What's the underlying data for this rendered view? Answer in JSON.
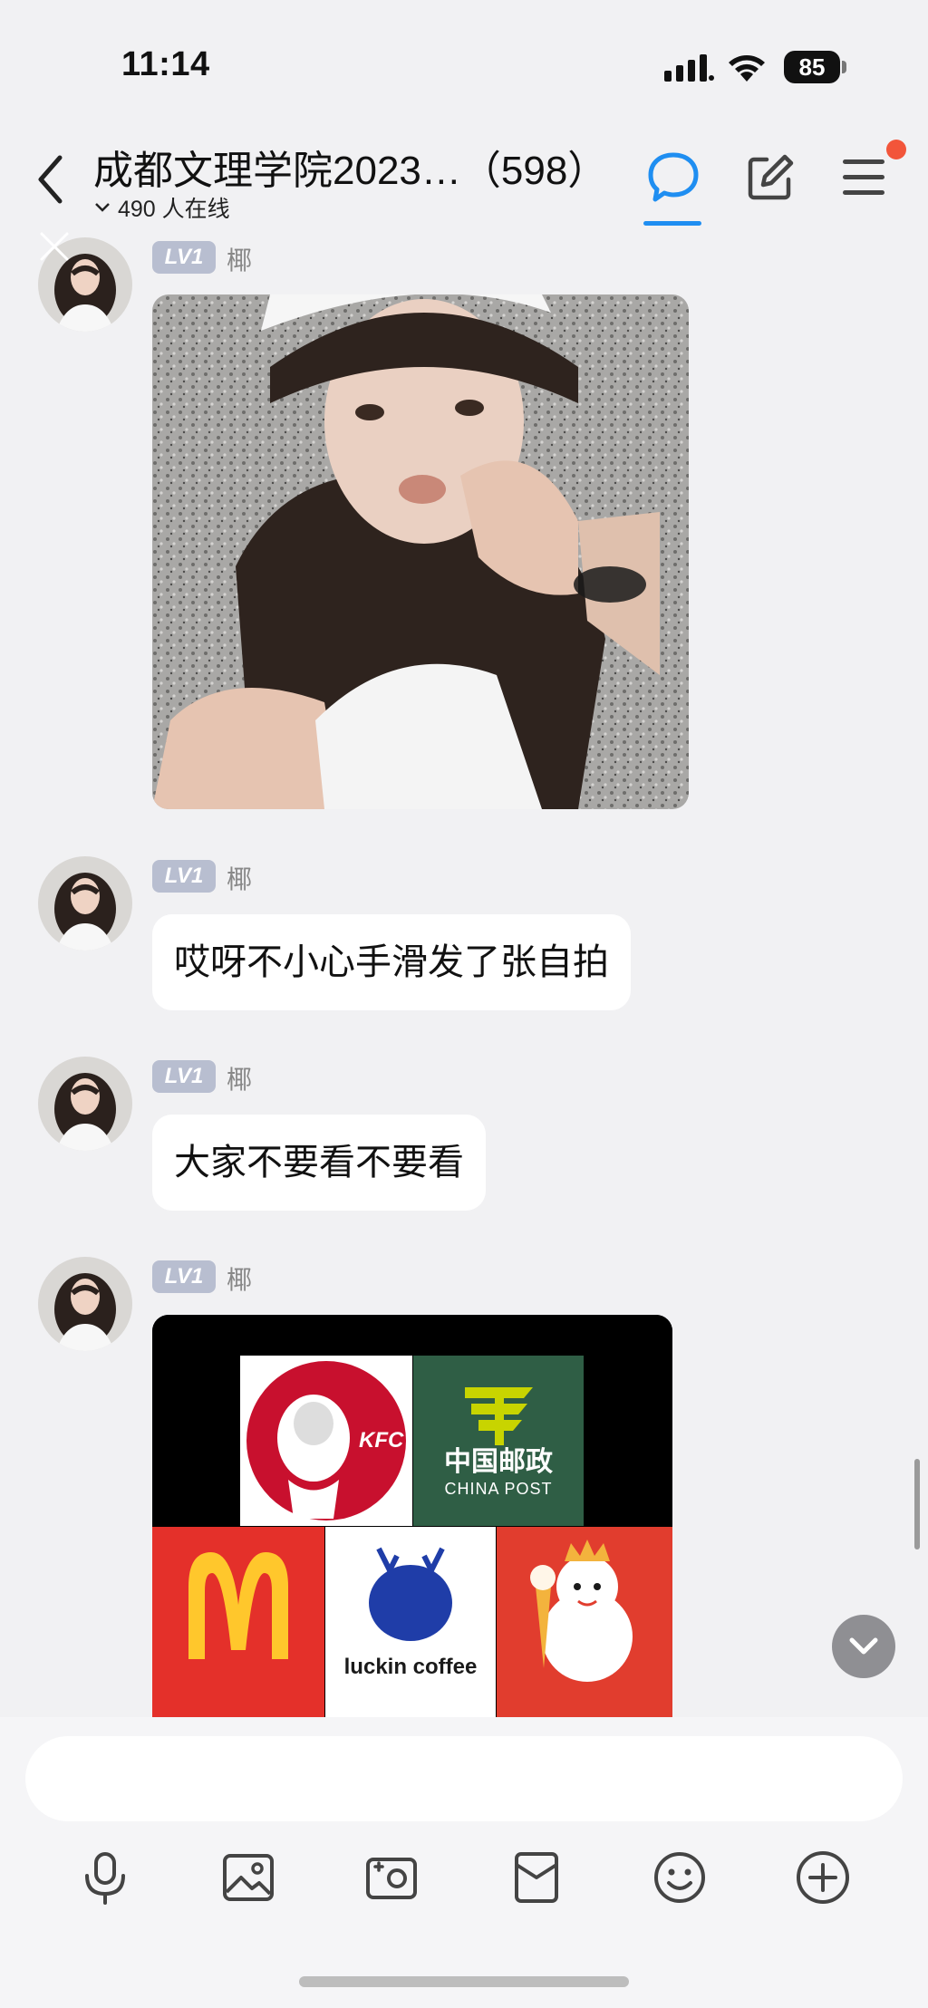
{
  "status_bar": {
    "time": "11:14",
    "battery": "85"
  },
  "header": {
    "title": "成都文理学院2023…（598）",
    "online": "490 人在线"
  },
  "messages": [
    {
      "level": "LV1",
      "sender": "椰",
      "type": "image",
      "image": "selfie photo"
    },
    {
      "level": "LV1",
      "sender": "椰",
      "type": "text",
      "text": "哎呀不小心手滑发了张自拍"
    },
    {
      "level": "LV1",
      "sender": "椰",
      "type": "text",
      "text": "大家不要看不要看"
    },
    {
      "level": "LV1",
      "sender": "椰",
      "type": "image",
      "image": "brand logos grid",
      "logo_texts": {
        "kfc": "KFC",
        "china_post_cn": "中国邮政",
        "china_post_en": "CHINA POST",
        "luckin": "luckin coffee"
      }
    }
  ],
  "input": {
    "placeholder": ""
  },
  "toolbar": {
    "icons": [
      "microphone-icon",
      "image-icon",
      "camera-icon",
      "red-packet-icon",
      "emoji-icon",
      "plus-icon"
    ]
  },
  "colors": {
    "accent": "#1f8ef1",
    "badge": "#b8bed0",
    "notification": "#f2553a"
  }
}
